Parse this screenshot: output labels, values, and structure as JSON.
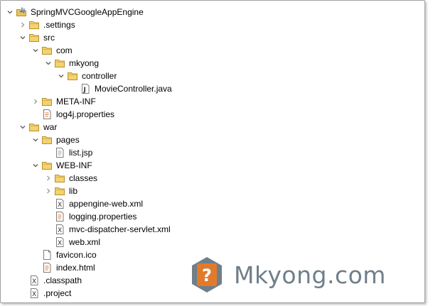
{
  "tree": [
    {
      "label": "SpringMVCGoogleAppEngine",
      "icon": "project-icon",
      "toggle": "expanded",
      "depth": 0
    },
    {
      "label": ".settings",
      "icon": "folder-icon",
      "toggle": "collapsed",
      "depth": 1
    },
    {
      "label": "src",
      "icon": "folder-icon",
      "toggle": "expanded",
      "depth": 1
    },
    {
      "label": "com",
      "icon": "folder-icon",
      "toggle": "expanded",
      "depth": 2
    },
    {
      "label": "mkyong",
      "icon": "folder-icon",
      "toggle": "expanded",
      "depth": 3
    },
    {
      "label": "controller",
      "icon": "folder-icon",
      "toggle": "expanded",
      "depth": 4
    },
    {
      "label": "MovieController.java",
      "icon": "java-file-icon",
      "toggle": "none",
      "depth": 5
    },
    {
      "label": "META-INF",
      "icon": "folder-icon",
      "toggle": "collapsed",
      "depth": 2
    },
    {
      "label": "log4j.properties",
      "icon": "properties-file-icon",
      "toggle": "none",
      "depth": 2
    },
    {
      "label": "war",
      "icon": "folder-icon",
      "toggle": "expanded",
      "depth": 1
    },
    {
      "label": "pages",
      "icon": "folder-icon",
      "toggle": "expanded",
      "depth": 2
    },
    {
      "label": "list.jsp",
      "icon": "jsp-file-icon",
      "toggle": "none",
      "depth": 3
    },
    {
      "label": "WEB-INF",
      "icon": "folder-icon",
      "toggle": "expanded",
      "depth": 2
    },
    {
      "label": "classes",
      "icon": "folder-icon",
      "toggle": "collapsed",
      "depth": 3
    },
    {
      "label": "lib",
      "icon": "folder-icon",
      "toggle": "collapsed",
      "depth": 3
    },
    {
      "label": "appengine-web.xml",
      "icon": "xml-file-icon",
      "toggle": "none",
      "depth": 3
    },
    {
      "label": "logging.properties",
      "icon": "properties-file-icon",
      "toggle": "none",
      "depth": 3
    },
    {
      "label": "mvc-dispatcher-servlet.xml",
      "icon": "xml-file-icon",
      "toggle": "none",
      "depth": 3
    },
    {
      "label": "web.xml",
      "icon": "xml-file-icon",
      "toggle": "none",
      "depth": 3
    },
    {
      "label": "favicon.ico",
      "icon": "file-icon",
      "toggle": "none",
      "depth": 2
    },
    {
      "label": "index.html",
      "icon": "html-file-icon",
      "toggle": "none",
      "depth": 2
    },
    {
      "label": ".classpath",
      "icon": "xml-file-icon",
      "toggle": "none",
      "depth": 1
    },
    {
      "label": ".project",
      "icon": "xml-file-icon",
      "toggle": "none",
      "depth": 1
    }
  ],
  "watermark": {
    "brand": "Mkyong.com",
    "badge_glyph": "?"
  },
  "colors": {
    "folder": "#e8c35a",
    "folder_stroke": "#b8902e",
    "brand": "#6f7f8a",
    "badge_bg": "#e27a2d"
  }
}
